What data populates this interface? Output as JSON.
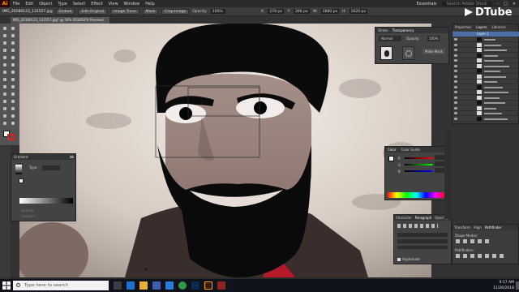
{
  "menubar": {
    "app_logo": "Ai",
    "items": [
      "File",
      "Edit",
      "Object",
      "Type",
      "Select",
      "Effect",
      "View",
      "Window",
      "Help"
    ],
    "workspace": "Essentials",
    "search_placeholder": "Search Adobe Stock"
  },
  "controlbar": {
    "image_label": "IMG_20180123_131557.jpg",
    "link_state": "Embed",
    "edit_original": "Edit Original",
    "image_trace": "Image Trace",
    "mask_label": "Mask",
    "crop_image": "Crop Image",
    "opacity_label": "Opacity:",
    "opacity_value": "100%",
    "x_label": "X:",
    "x_value": "378 px",
    "y_label": "Y:",
    "y_value": "286 px",
    "w_label": "W:",
    "w_value": "2880 px",
    "h_label": "H:",
    "h_value": "1620 px"
  },
  "document_tab": "IMG_20180123_131557.jpg* @ 50% (RGB/GPU Preview)",
  "watermark": "DTube",
  "gradient_panel": {
    "title": "Gradient",
    "type_label": "Type:",
    "opacity_label": "Opacity:",
    "location_label": "Location:"
  },
  "transparency_panel": {
    "tabs": [
      "Stroke",
      "Transparency"
    ],
    "blend_mode": "Normal",
    "opacity_label": "Opacity:",
    "opacity_value": "100%",
    "make_mask": "Make Mask"
  },
  "color_panel": {
    "tabs": [
      "Color",
      "Color Guide"
    ],
    "channels": [
      "R",
      "G",
      "B"
    ]
  },
  "paragraph_panel": {
    "tabs": [
      "Character",
      "Paragraph",
      "OpenType"
    ],
    "hyphenate": "Hyphenate"
  },
  "layers_panel": {
    "tabs": [
      "Properties",
      "Layers",
      "Libraries"
    ],
    "top_layer": "Layer 1"
  },
  "transform_panel": {
    "tabs": [
      "Transform",
      "Align",
      "Pathfinder"
    ],
    "shape_modes": "Shape Modes:",
    "pathfinders": "Pathfinders:"
  },
  "taskbar": {
    "search_placeholder": "Type here to search",
    "time": "9:17 AM",
    "date": "11/26/2018"
  },
  "colors": {
    "ui_dark": "#323232",
    "panel": "#434343",
    "accent": "#ff9a00",
    "taskbar": "#101319"
  }
}
